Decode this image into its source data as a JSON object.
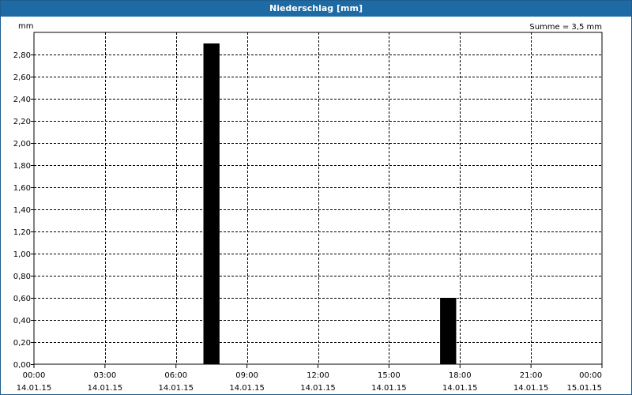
{
  "window": {
    "title": "Niederschlag [mm]"
  },
  "summary": "Summe = 3,5 mm",
  "chart_data": {
    "type": "bar",
    "title": "Niederschlag [mm]",
    "ylabel": "mm",
    "xlabel": "",
    "ylim": [
      0,
      3.0
    ],
    "xlim": [
      "2015-01-14 00:00",
      "2015-01-15 00:00"
    ],
    "grid": true,
    "yticks": [
      0,
      0.2,
      0.4,
      0.6,
      0.8,
      1.0,
      1.2,
      1.4,
      1.6,
      1.8,
      2.0,
      2.2,
      2.4,
      2.6,
      2.8
    ],
    "ytick_labels": [
      "0,00",
      "0,20",
      "0,40",
      "0,60",
      "0,80",
      "1,00",
      "1,20",
      "1,40",
      "1,60",
      "1,80",
      "2,00",
      "2,20",
      "2,40",
      "2,60",
      "2,80"
    ],
    "xticks": [
      {
        "time": "00:00",
        "date": "14.01.15",
        "hour": 0
      },
      {
        "time": "03:00",
        "date": "14.01.15",
        "hour": 3
      },
      {
        "time": "06:00",
        "date": "14.01.15",
        "hour": 6
      },
      {
        "time": "09:00",
        "date": "14.01.15",
        "hour": 9
      },
      {
        "time": "12:00",
        "date": "14.01.15",
        "hour": 12
      },
      {
        "time": "15:00",
        "date": "14.01.15",
        "hour": 15
      },
      {
        "time": "18:00",
        "date": "14.01.15",
        "hour": 18
      },
      {
        "time": "21:00",
        "date": "14.01.15",
        "hour": 21
      },
      {
        "time": "00:00",
        "date": "15.01.15",
        "hour": 24
      }
    ],
    "bars": [
      {
        "start": "2015-01-14 07:00",
        "end": "2015-01-14 08:00",
        "start_hour": 7,
        "end_hour": 8,
        "value": 2.9
      },
      {
        "start": "2015-01-14 17:00",
        "end": "2015-01-14 18:00",
        "start_hour": 17,
        "end_hour": 18,
        "value": 0.6
      }
    ],
    "bar_color": "#000000"
  }
}
